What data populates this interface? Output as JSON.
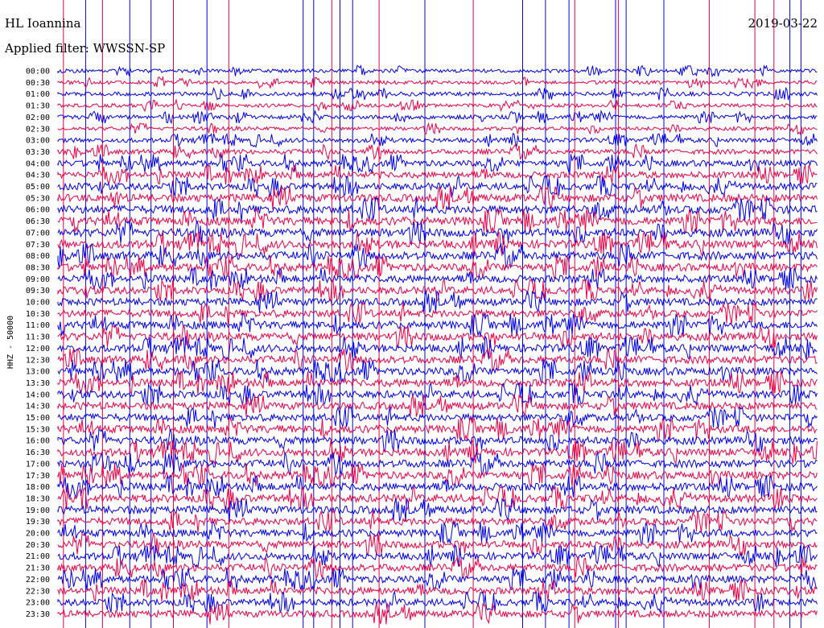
{
  "header": {
    "station": "HL Ioannina",
    "filter": "Applied filter: WWSSN-SP",
    "date": "2019-03-22"
  },
  "chart_data": {
    "type": "helicorder",
    "channel_label": "HHZ - 50000",
    "row_labels": [
      "00:00",
      "00:30",
      "01:00",
      "01:30",
      "02:00",
      "02:30",
      "03:00",
      "03:30",
      "04:00",
      "04:30",
      "05:00",
      "05:30",
      "06:00",
      "06:30",
      "07:00",
      "07:30",
      "08:00",
      "08:30",
      "09:00",
      "09:30",
      "10:00",
      "10:30",
      "11:00",
      "11:30",
      "12:00",
      "12:30",
      "13:00",
      "13:30",
      "14:00",
      "14:30",
      "15:00",
      "15:30",
      "16:00",
      "16:30",
      "17:00",
      "17:30",
      "18:00",
      "18:30",
      "19:00",
      "19:30",
      "20:00",
      "20:30",
      "21:00",
      "21:30",
      "22:00",
      "22:30",
      "23:00",
      "23:30"
    ],
    "minutes_per_row": 30,
    "trace_colors": [
      "#0000ee",
      "#ee0044"
    ],
    "relative_amplitude_by_row": [
      0.45,
      0.45,
      0.5,
      0.45,
      0.5,
      0.45,
      0.55,
      0.6,
      0.75,
      0.8,
      0.85,
      0.95,
      1.0,
      1.0,
      1.0,
      1.0,
      1.0,
      0.95,
      0.9,
      0.9,
      0.9,
      0.9,
      0.95,
      0.95,
      0.95,
      0.95,
      0.95,
      0.95,
      0.9,
      0.9,
      0.9,
      0.95,
      0.95,
      0.95,
      0.95,
      0.95,
      0.95,
      0.95,
      0.95,
      0.9,
      0.9,
      0.9,
      0.9,
      0.9,
      0.9,
      0.9,
      0.85,
      0.85
    ],
    "event_marker_minutes": [
      2.8,
      14.2,
      22.9,
      36.9,
      47.8,
      59.3,
      76.5,
      87.7,
      125.9,
      131.3,
      140.6,
      144.8,
      151.3,
      164.9,
      188.4,
      213.2,
      238.6,
      250.3,
      262.4,
      265.3,
      286.3,
      287.7,
      291.7,
      311.1,
      334.4,
      357.8,
      367.6,
      375.8,
      381.5
    ],
    "event_marker_colors": [
      "#ee0044",
      "#0000ee",
      "#ee0044",
      "#0000ee",
      "#0000ee",
      "#ee0044",
      "#0000ee",
      "#ee0044",
      "#0000ee",
      "#0000ee",
      "#ee0044",
      "#0000ee",
      "#0000ee",
      "#ee0044",
      "#0000ee",
      "#ee0044",
      "#0000ee",
      "#0000ee",
      "#0000ee",
      "#ee0044",
      "#0000ee",
      "#ee0044",
      "#0000ee",
      "#0000ee",
      "#ee0044",
      "#ee0044",
      "#ee0044",
      "#0000ee",
      "#0000ee"
    ]
  }
}
